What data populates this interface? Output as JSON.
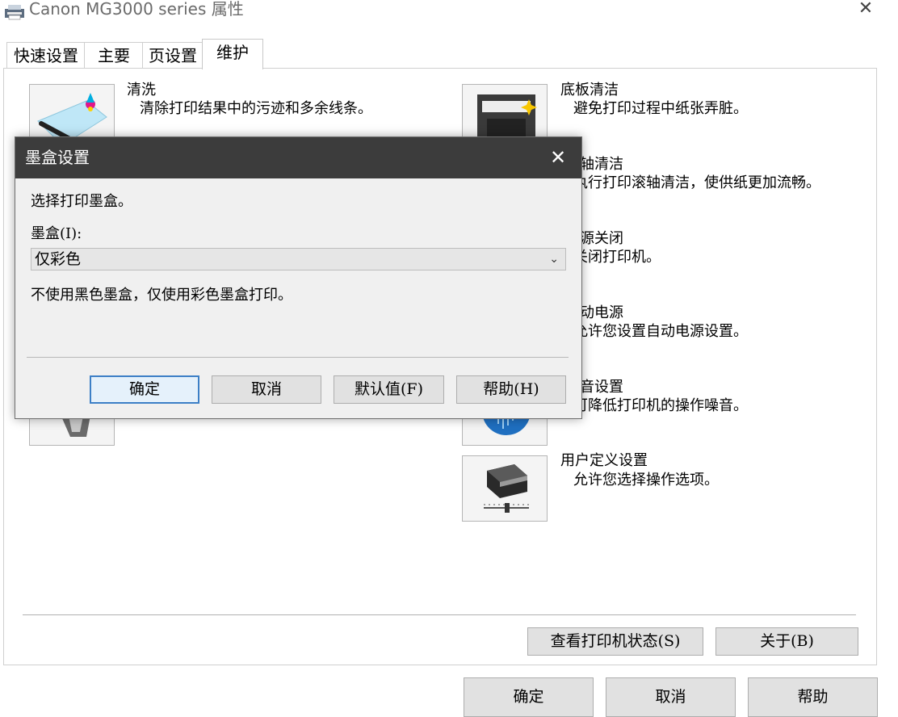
{
  "window": {
    "title": "Canon MG3000 series 属性",
    "close_glyph": "✕"
  },
  "tabs": [
    {
      "label": "快速设置",
      "active": false
    },
    {
      "label": "主要",
      "active": false
    },
    {
      "label": "页设置",
      "active": false
    },
    {
      "label": "维护",
      "active": true
    }
  ],
  "left_items": [
    {
      "title": "清洗",
      "desc": "清除打印结果中的污迹和多余线条。",
      "icon": "cleaning-icon"
    }
  ],
  "right_items": [
    {
      "title": "底板清洁",
      "desc": "避免打印过程中纸张弄脏。",
      "icon": "bottom-plate-cleaning-icon"
    },
    {
      "title": "轴清洁",
      "desc": "执行打印滚轴清洁，使供纸更加流畅。",
      "icon": "roller-cleaning-icon"
    },
    {
      "title": "源关闭",
      "desc": "关闭打印机。",
      "icon": "power-off-icon"
    },
    {
      "title": "动电源",
      "desc": "允许您设置自动电源设置。",
      "icon": "auto-power-icon"
    },
    {
      "title": "音设置",
      "desc": "可降低打印机的操作噪音。",
      "icon": "quiet-settings-icon"
    },
    {
      "title": "用户定义设置",
      "desc": "允许您选择操作选项。",
      "icon": "custom-settings-icon"
    }
  ],
  "panel_buttons": {
    "printer_status": "查看打印机状态(S)",
    "about": "关于(B)"
  },
  "bottom_buttons": {
    "ok": "确定",
    "cancel": "取消",
    "help": "帮助"
  },
  "dialog": {
    "title": "墨盒设置",
    "close_glyph": "✕",
    "instruction": "选择打印墨盒。",
    "field_label": "墨盒(I):",
    "selected_value": "仅彩色",
    "chevron_glyph": "⌄",
    "description": "不使用黑色墨盒，仅使用彩色墨盒打印。",
    "buttons": {
      "ok": "确定",
      "cancel": "取消",
      "defaults": "默认值(F)",
      "help": "帮助(H)"
    }
  },
  "colors": {
    "dialog_title_bg": "#3c3c3c",
    "focus_border": "#3c7fc6",
    "button_bg": "#e1e1e1"
  }
}
